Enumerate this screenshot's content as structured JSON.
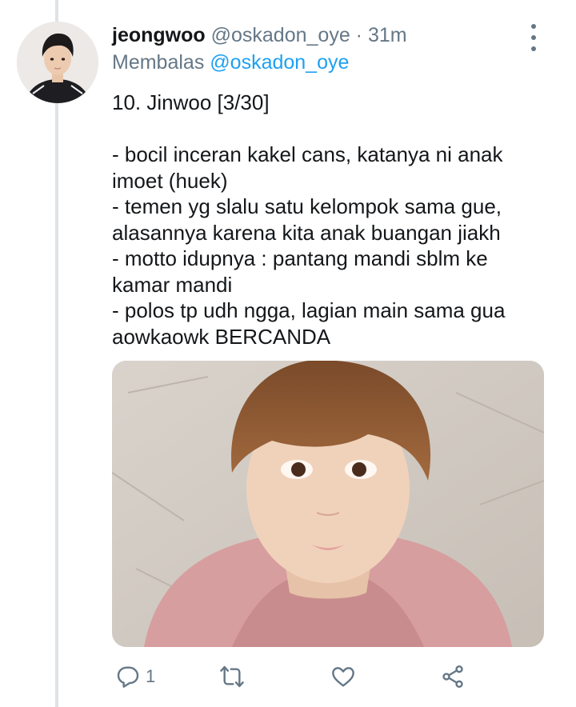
{
  "tweet": {
    "username": "jeongwoo",
    "handle": "@oskadon_oye",
    "separator": "·",
    "time": "31m",
    "reply_prefix": "Membalas",
    "reply_mention": "@oskadon_oye",
    "text": "10. Jinwoo [3/30]\n\n- bocil inceran kakel cans, katanya ni anak imoet (huek)\n- temen yg slalu satu kelompok sama gue, alasannya karena kita anak buangan jiakh\n- motto idupnya : pantang mandi sblm ke kamar mandi\n- polos tp udh ngga, lagian main sama gua aowkaowk BERCANDA",
    "actions": {
      "reply_count": "1",
      "retweet_count": "",
      "like_count": ""
    }
  },
  "icons": {
    "more": "more-vertical-icon",
    "reply": "reply-icon",
    "retweet": "retweet-icon",
    "like": "heart-icon",
    "share": "share-icon"
  },
  "colors": {
    "text": "#14171a",
    "secondary": "#657786",
    "link": "#1da1f2",
    "thread_line": "#dfe3e6"
  }
}
